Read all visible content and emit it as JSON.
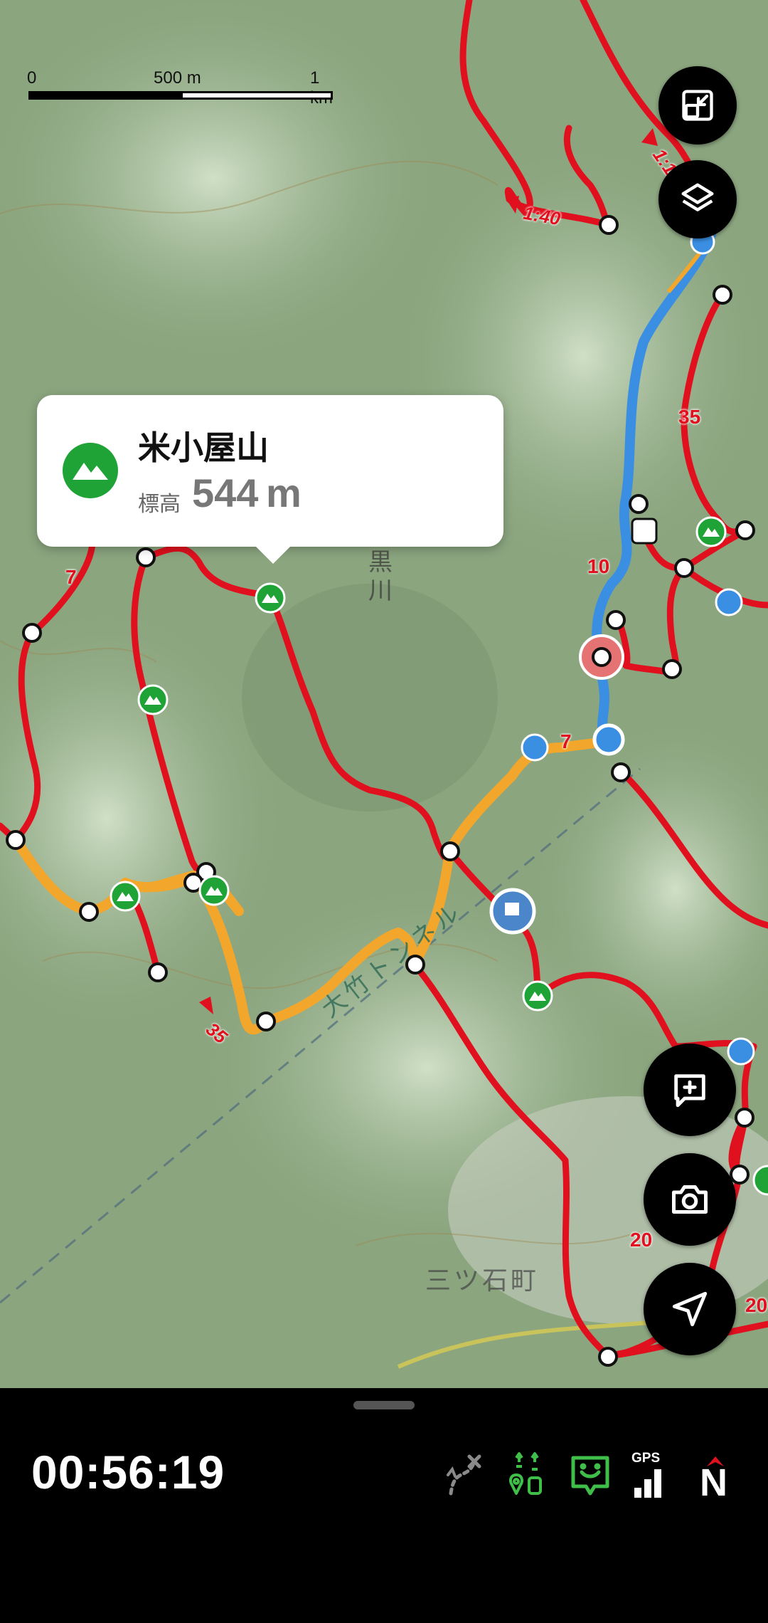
{
  "scale": {
    "zero": "0",
    "mid": "500 m",
    "end": "1 km"
  },
  "map_labels": {
    "river": "黒川",
    "town": "三ツ石町",
    "tunnel": "大竹トンネル",
    "times": [
      "1:40",
      "1:1",
      "35"
    ],
    "route_numbers": [
      "35",
      "10",
      "7",
      "7",
      "20",
      "20"
    ]
  },
  "popup": {
    "name": "米小屋山",
    "elevation_label": "標高",
    "elevation_value": "544",
    "elevation_unit": "m"
  },
  "bottom_bar": {
    "elapsed_time": "00:56:19",
    "gps_label": "GPS",
    "compass_label": "N"
  },
  "icons": {
    "fullscreen": "exit-fullscreen-icon",
    "layers": "layers-icon",
    "add_note": "add-note-icon",
    "camera": "camera-icon",
    "locate": "navigation-arrow-icon",
    "peak": "mountain-icon"
  },
  "colors": {
    "route_red": "#e0101e",
    "route_orange": "#f2a72c",
    "track_blue": "#3b8fe3",
    "peak_green": "#1fa336",
    "accent_green": "#3fbf4a"
  }
}
